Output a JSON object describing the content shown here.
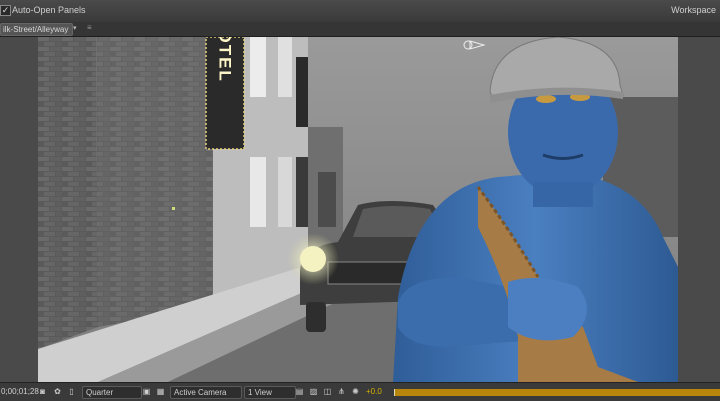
{
  "topbar": {
    "auto_open_label": "Auto-Open Panels",
    "workspace_label": "Workspace",
    "checked_mark": "✓"
  },
  "viewer_tab": {
    "breadcrumb": "ilk-Street/Alleyway",
    "arrow": "▾",
    "menu": "≡"
  },
  "scene": {
    "sign_text": "HOTEL"
  },
  "bottombar": {
    "timecode": "0;00;01;28",
    "resolution": "Quarter",
    "camera": "Active Camera",
    "views": "1 View",
    "exposure": "+0.0"
  },
  "icons": [
    "camera-icon",
    "color-channels-icon",
    "region-of-interest-icon",
    "transparency-grid-icon",
    "fast-preview-icon",
    "flowchart-icon",
    "exposure-icon"
  ],
  "colors": {
    "time_bar": "#b8860b",
    "exposure_text": "#d4b000",
    "skin_blue": "#3d6fae"
  }
}
